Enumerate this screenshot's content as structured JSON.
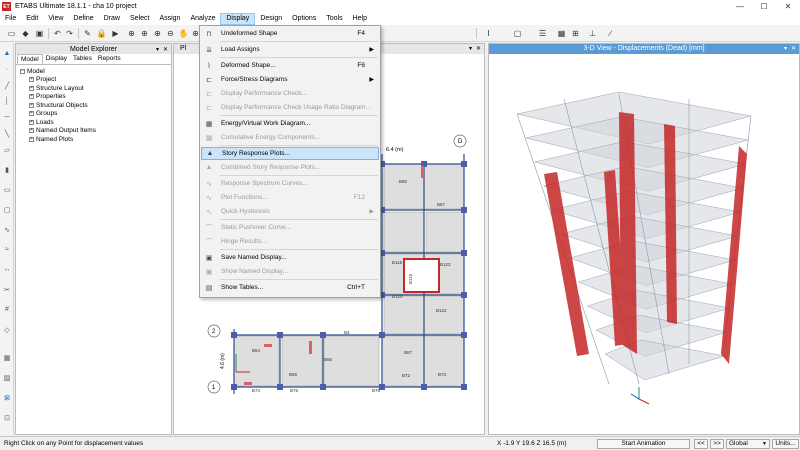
{
  "window": {
    "icon_text": "ET",
    "title": "ETABS Ultimate 18.1.1 - cha 10 project",
    "minimize": "—",
    "maximize": "☐",
    "close": "✕"
  },
  "menubar": [
    "File",
    "Edit",
    "View",
    "Define",
    "Draw",
    "Select",
    "Assign",
    "Analyze",
    "Display",
    "Design",
    "Options",
    "Tools",
    "Help"
  ],
  "explorer": {
    "title": "Model Explorer",
    "tabs": [
      "Model",
      "Display",
      "Tables",
      "Reports"
    ],
    "root": "Model",
    "items": [
      "Project",
      "Structure Layout",
      "Properties",
      "Structural Objects",
      "Groups",
      "Loads",
      "Named Output Items",
      "Named Plots"
    ]
  },
  "plan_view": {
    "title": "Pl",
    "dimension_label": "6.4 (m)",
    "dimension_label_left": "4.6 (m)",
    "grid_top": [
      "D"
    ],
    "grid_left": [
      "3",
      "2",
      "1"
    ],
    "beam_labels": [
      "B50",
      "B57",
      "B116",
      "B123",
      "B115",
      "B120",
      "B122",
      "B3",
      "B64",
      "B65",
      "B66",
      "B67",
      "B74",
      "B75",
      "B76",
      "B72",
      "B73"
    ]
  },
  "view3d": {
    "title": "3-D View  - Displacements (Dead)  [mm]"
  },
  "dropdown": {
    "items": [
      {
        "label": "Undeformed Shape",
        "shortcut": "F4",
        "icon": "frame-icon",
        "disabled": false,
        "submenu": false
      },
      {
        "label": "Load Assigns",
        "shortcut": "",
        "icon": "load-icon",
        "disabled": false,
        "submenu": true
      },
      {
        "label": "Deformed Shape...",
        "shortcut": "F6",
        "icon": "deformed-icon",
        "disabled": false,
        "submenu": false
      },
      {
        "label": "Force/Stress Diagrams",
        "shortcut": "",
        "icon": "force-icon",
        "disabled": false,
        "submenu": true
      },
      {
        "label": "Display Performance Check...",
        "shortcut": "",
        "icon": "perf-icon",
        "disabled": true,
        "submenu": false
      },
      {
        "label": "Display Performance Check Usage Ratio Diagram...",
        "shortcut": "",
        "icon": "perf-ratio-icon",
        "disabled": true,
        "submenu": false
      },
      {
        "label": "Energy/Virtual Work Diagram...",
        "shortcut": "",
        "icon": "energy-icon",
        "disabled": false,
        "submenu": false
      },
      {
        "label": "Cumulative Energy Components...",
        "shortcut": "",
        "icon": "cumulative-icon",
        "disabled": true,
        "submenu": false
      },
      {
        "label": "Story Response Plots...",
        "shortcut": "",
        "icon": "story-icon",
        "disabled": false,
        "submenu": false,
        "highlighted": true
      },
      {
        "label": "Combined Story Response Plots...",
        "shortcut": "",
        "icon": "combined-icon",
        "disabled": true,
        "submenu": false
      },
      {
        "label": "Response Spectrum Curves...",
        "shortcut": "",
        "icon": "spectrum-icon",
        "disabled": true,
        "submenu": false
      },
      {
        "label": "Plot Functions...",
        "shortcut": "F12",
        "icon": "plot-fn-icon",
        "disabled": true,
        "submenu": false
      },
      {
        "label": "Quick Hysteresis",
        "shortcut": "",
        "icon": "hysteresis-icon",
        "disabled": true,
        "submenu": true
      },
      {
        "label": "Static Pushover Curve...",
        "shortcut": "",
        "icon": "pushover-icon",
        "disabled": true,
        "submenu": false
      },
      {
        "label": "Hinge Results...",
        "shortcut": "",
        "icon": "hinge-icon",
        "disabled": true,
        "submenu": false
      },
      {
        "label": "Save Named Display...",
        "shortcut": "",
        "icon": "save-display-icon",
        "disabled": false,
        "submenu": false
      },
      {
        "label": "Show Named Display...",
        "shortcut": "",
        "icon": "show-display-icon",
        "disabled": true,
        "submenu": false
      },
      {
        "label": "Show Tables...",
        "shortcut": "Ctrl+T",
        "icon": "tables-icon",
        "disabled": false,
        "submenu": false
      }
    ]
  },
  "statusbar": {
    "message": "Right Click on any Point for displacement values",
    "coords": "X -1.9  Y 19.6  Z 16.5 (m)",
    "start_animation": "Start Animation",
    "prev": "<<",
    "next": ">>",
    "coord_system": "Global",
    "units": "Units..."
  },
  "colors": {
    "accent": "#5b9bd5",
    "menu_highlight": "#cce4f7",
    "shear_wall": "#c62828"
  }
}
